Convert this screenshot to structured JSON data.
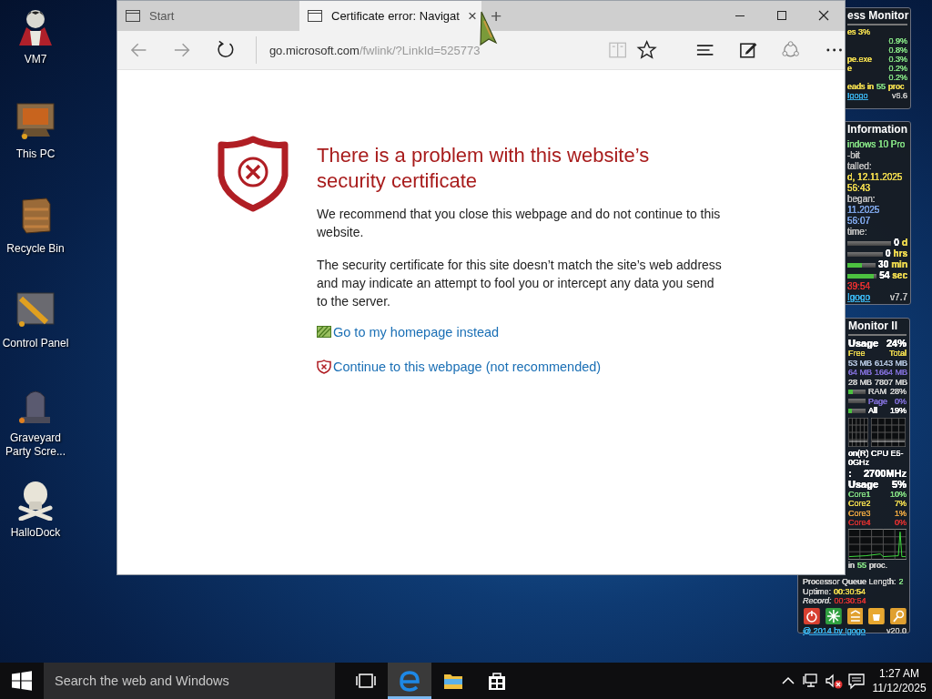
{
  "desktop_icons": [
    {
      "label": "VM7",
      "kind": "figure"
    },
    {
      "label": "This PC",
      "kind": "monitor"
    },
    {
      "label": "Recycle Bin",
      "kind": "crate"
    },
    {
      "label": "Control Panel",
      "kind": "panel"
    },
    {
      "label": "Graveyard Party Scre...",
      "kind": "tombstone"
    },
    {
      "label": "HalloDock",
      "kind": "skull"
    }
  ],
  "gadgets": [
    {
      "title": "ess Monitor",
      "rows": [
        {
          "kind": "line",
          "cells": [
            {
              "text": "es 3%",
              "color": "#e8d44d"
            }
          ]
        },
        {
          "kind": "right",
          "cells": [
            {
              "text": "0.9%",
              "color": "#7fd67f"
            }
          ]
        },
        {
          "kind": "right",
          "cells": [
            {
              "text": "0.8%",
              "color": "#7fd67f"
            }
          ]
        },
        {
          "kind": "split",
          "cells": [
            {
              "text": "pe.exe",
              "color": "#e8d44d"
            },
            {
              "text": "0.3%",
              "color": "#7fd67f"
            }
          ]
        },
        {
          "kind": "split",
          "cells": [
            {
              "text": "e",
              "color": "#e8d44d"
            },
            {
              "text": "0.2%",
              "color": "#7fd67f"
            }
          ]
        },
        {
          "kind": "right",
          "cells": [
            {
              "text": "0.2%",
              "color": "#7fd67f"
            }
          ]
        },
        {
          "kind": "line",
          "cells": [
            {
              "text": "eads in",
              "color": "#e8d44d"
            },
            {
              "text": "55",
              "color": "#7fd67f"
            },
            {
              "text": "proc",
              "color": "#e8d44d"
            }
          ]
        },
        {
          "kind": "split",
          "cells": [
            {
              "text": "Igogo",
              "color": "#3ab0e8",
              "link": true
            },
            {
              "text": "v6.6",
              "color": "#bbbbbb"
            }
          ]
        }
      ]
    },
    {
      "title": "Information",
      "rows": [
        {
          "kind": "line",
          "cells": [
            {
              "text": "indows 10 Pro",
              "color": "#7fd67f"
            }
          ]
        },
        {
          "kind": "line",
          "cells": [
            {
              "text": "-bit",
              "color": "#b8b8b8"
            }
          ]
        },
        {
          "kind": "line",
          "cells": [
            {
              "text": "talled:",
              "color": "#b8b8b8"
            }
          ]
        },
        {
          "kind": "line",
          "cells": [
            {
              "text": "d, 12.11.2025",
              "color": "#e8d44d"
            }
          ]
        },
        {
          "kind": "line",
          "cells": [
            {
              "text": "56:43",
              "color": "#e8d44d"
            }
          ]
        },
        {
          "kind": "line",
          "cells": [
            {
              "text": "began:",
              "color": "#b8b8b8"
            }
          ]
        },
        {
          "kind": "line",
          "cells": [
            {
              "text": "11.2025",
              "color": "#7aa0e0"
            }
          ]
        },
        {
          "kind": "line",
          "cells": [
            {
              "text": "56:07",
              "color": "#7aa0e0"
            }
          ]
        },
        {
          "kind": "line",
          "cells": [
            {
              "text": "time:",
              "color": "#b8b8b8"
            }
          ]
        },
        {
          "kind": "bar",
          "level": 0,
          "cells": [
            {
              "text": "0",
              "color": "#ffffff"
            },
            {
              "text": "d",
              "color": "#e8d44d"
            }
          ]
        },
        {
          "kind": "bar",
          "level": 0,
          "cells": [
            {
              "text": "0",
              "color": "#ffffff"
            },
            {
              "text": "hrs",
              "color": "#e8d44d"
            }
          ]
        },
        {
          "kind": "bar",
          "level": 0.5,
          "cells": [
            {
              "text": "30",
              "color": "#ffffff"
            },
            {
              "text": "min",
              "color": "#e8d44d"
            }
          ]
        },
        {
          "kind": "bar",
          "level": 0.9,
          "cells": [
            {
              "text": "54",
              "color": "#ffffff"
            },
            {
              "text": "sec",
              "color": "#e8d44d"
            }
          ]
        },
        {
          "kind": "line",
          "cells": [
            {
              "text": "39:54",
              "color": "#e03030"
            }
          ]
        },
        {
          "kind": "split",
          "cells": [
            {
              "text": "Igogo",
              "color": "#3ab0e8",
              "link": true
            },
            {
              "text": "v7.7",
              "color": "#bbbbbb"
            }
          ]
        }
      ]
    },
    {
      "title": "Monitor II",
      "rows": [
        {
          "kind": "head",
          "cells": [
            {
              "text": "Usage",
              "color": "#ffffff"
            },
            {
              "text": "24%",
              "color": "#ffffff"
            }
          ]
        },
        {
          "kind": "split",
          "cells": [
            {
              "text": "Free",
              "color": "#e8d44d"
            },
            {
              "text": "Total",
              "color": "#e8d44d"
            }
          ]
        },
        {
          "kind": "split",
          "cells": [
            {
              "text": "53 MB",
              "color": "#a8b8d0"
            },
            {
              "text": "6143 MB",
              "color": "#a8b8d0"
            }
          ]
        },
        {
          "kind": "split",
          "cells": [
            {
              "text": "64 MB",
              "color": "#7868c8"
            },
            {
              "text": "1664 MB",
              "color": "#7868c8"
            }
          ]
        },
        {
          "kind": "split",
          "cells": [
            {
              "text": "28 MB",
              "color": "#c8c8c8"
            },
            {
              "text": "7807 MB",
              "color": "#c8c8c8"
            }
          ]
        },
        {
          "kind": "bar",
          "level": 0.28,
          "cells": [
            {
              "text": "RAM",
              "color": "#c8c8c8"
            },
            {
              "text": "28%",
              "color": "#c8c8c8"
            }
          ]
        },
        {
          "kind": "bar",
          "level": 0,
          "cells": [
            {
              "text": "Page",
              "color": "#7868c8"
            },
            {
              "text": "0%",
              "color": "#7868c8"
            }
          ]
        },
        {
          "kind": "bar",
          "level": 0.19,
          "cells": [
            {
              "text": "All",
              "color": "#ffffff"
            },
            {
              "text": "19%",
              "color": "#ffffff"
            }
          ]
        },
        {
          "kind": "graph_pair"
        },
        {
          "kind": "line",
          "cells": [
            {
              "text": "on(R) CPU E5-",
              "color": "#ffffff"
            }
          ]
        },
        {
          "kind": "line",
          "cells": [
            {
              "text": "0GHz",
              "color": "#ffffff"
            }
          ]
        },
        {
          "kind": "head",
          "cells": [
            {
              "text": ":",
              "color": "#ffffff"
            },
            {
              "text": "2700MHz",
              "color": "#ffffff"
            }
          ]
        },
        {
          "kind": "head",
          "cells": [
            {
              "text": "Usage",
              "color": "#ffffff"
            },
            {
              "text": "5%",
              "color": "#ffffff"
            }
          ]
        },
        {
          "kind": "split",
          "cells": [
            {
              "text": "Core1",
              "color": "#7fd67f"
            },
            {
              "text": "10%",
              "color": "#7fd67f"
            }
          ]
        },
        {
          "kind": "split",
          "cells": [
            {
              "text": "Core2",
              "color": "#e8d44d"
            },
            {
              "text": "7%",
              "color": "#e8d44d"
            }
          ]
        },
        {
          "kind": "split",
          "cells": [
            {
              "text": "Core3",
              "color": "#e0a040"
            },
            {
              "text": "1%",
              "color": "#e0a040"
            }
          ]
        },
        {
          "kind": "split",
          "cells": [
            {
              "text": "Core4",
              "color": "#d03030"
            },
            {
              "text": "0%",
              "color": "#d03030"
            }
          ]
        },
        {
          "kind": "graph"
        },
        {
          "kind": "line",
          "cells": [
            {
              "text": "in",
              "color": "#c8c8c8"
            },
            {
              "text": "55",
              "color": "#7fd67f"
            },
            {
              "text": "proc.",
              "color": "#c8c8c8"
            }
          ]
        }
      ],
      "footer_rows": [
        {
          "kind": "line",
          "cells": [
            {
              "text": "Processor Queue Length:",
              "color": "#c8c8c8"
            },
            {
              "text": "2",
              "color": "#7fd67f"
            }
          ]
        },
        {
          "kind": "line",
          "cells": [
            {
              "text": "Uptime:",
              "color": "#c8c8c8"
            },
            {
              "text": "00:30:54",
              "color": "#e8d44d"
            }
          ]
        },
        {
          "kind": "line",
          "cells": [
            {
              "text": "Record:",
              "color": "#c8c8c8",
              "italic": true
            },
            {
              "text": "00:30:54",
              "color": "#d03030"
            }
          ]
        },
        {
          "kind": "buttons",
          "buttons": [
            {
              "kind": "power",
              "color": "#d84030"
            },
            {
              "kind": "spark",
              "color": "#30a040"
            },
            {
              "kind": "lines",
              "color": "#e0a030"
            },
            {
              "kind": "cup",
              "color": "#e8a830"
            },
            {
              "kind": "key",
              "color": "#e0a030"
            }
          ]
        },
        {
          "kind": "split",
          "cells": [
            {
              "text": "@ 2014 by Igogo",
              "color": "#3ab0e8",
              "link": true
            },
            {
              "text": "v20.0",
              "color": "#bbbbbb"
            }
          ]
        }
      ]
    }
  ],
  "browser": {
    "tabs": [
      {
        "label": "Start",
        "selected": false
      },
      {
        "label": "Certificate error: Navigat",
        "selected": true,
        "close": "×"
      }
    ],
    "new_tab": "+",
    "address": {
      "domain": "go.microsoft.com",
      "path": "/fwlink/?LinkId=525773"
    },
    "page": {
      "title": "There is a problem with this website’s security certificate",
      "paragraphs": [
        "We recommend that you close this webpage and do not continue to this website.",
        "The security certificate for this site doesn’t match the site’s web address and may indicate an attempt to fool you or intercept any data you send to the server."
      ],
      "links": [
        {
          "text": "Go to my homepage instead",
          "kind": "home"
        },
        {
          "text": "Continue to this webpage (not recommended)",
          "kind": "continue"
        }
      ]
    }
  },
  "taskbar": {
    "search_placeholder": "Search the web and Windows",
    "apps": [
      {
        "kind": "task_view",
        "active": false
      },
      {
        "kind": "browser",
        "active": true
      },
      {
        "kind": "folder",
        "active": false
      },
      {
        "kind": "store",
        "active": false
      }
    ],
    "tray": [
      {
        "kind": "chevron"
      },
      {
        "kind": "network"
      },
      {
        "kind": "volume_muted"
      },
      {
        "kind": "notifications"
      }
    ],
    "time": "1:27 AM",
    "date": "11/12/2025"
  }
}
